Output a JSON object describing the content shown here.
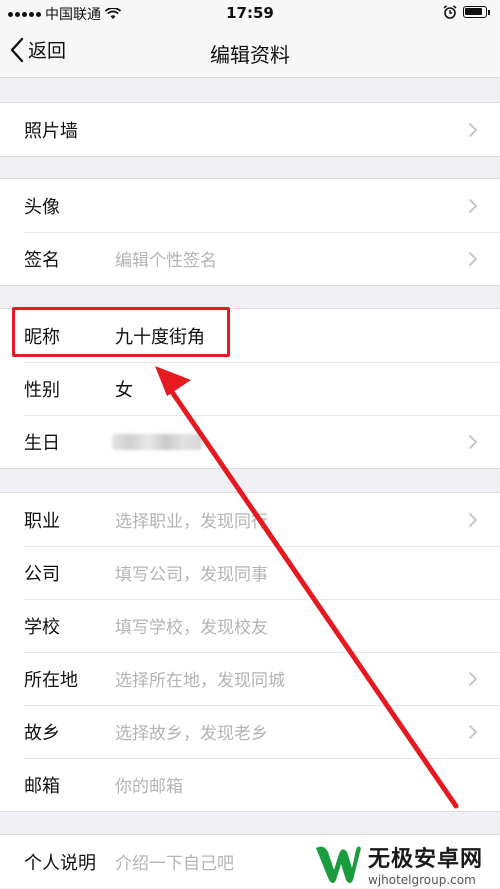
{
  "status_bar": {
    "carrier": "中国联通",
    "time": "17:59"
  },
  "nav": {
    "back_label": "返回",
    "title": "编辑资料"
  },
  "group1": {
    "photo_wall": "照片墙"
  },
  "group2": {
    "avatar": "头像",
    "signature_label": "签名",
    "signature_placeholder": "编辑个性签名"
  },
  "group3": {
    "nickname_label": "昵称",
    "nickname_value": "九十度街角",
    "gender_label": "性别",
    "gender_value": "女",
    "birthday_label": "生日"
  },
  "group4": {
    "job_label": "职业",
    "job_placeholder": "选择职业，发现同行",
    "company_label": "公司",
    "company_placeholder": "填写公司，发现同事",
    "school_label": "学校",
    "school_placeholder": "填写学校，发现校友",
    "location_label": "所在地",
    "location_placeholder": "选择所在地，发现同城",
    "hometown_label": "故乡",
    "hometown_placeholder": "选择故乡，发现老乡",
    "email_label": "邮箱",
    "email_placeholder": "你的邮箱"
  },
  "group5": {
    "bio_label": "个人说明",
    "bio_placeholder": "介绍一下自己吧"
  },
  "watermark": {
    "title": "无极安卓网",
    "url": "wjhotelgroup.com"
  },
  "colors": {
    "highlight": "#e5191f",
    "placeholder": "#b4b4b4",
    "page_bg": "#efeff4"
  }
}
